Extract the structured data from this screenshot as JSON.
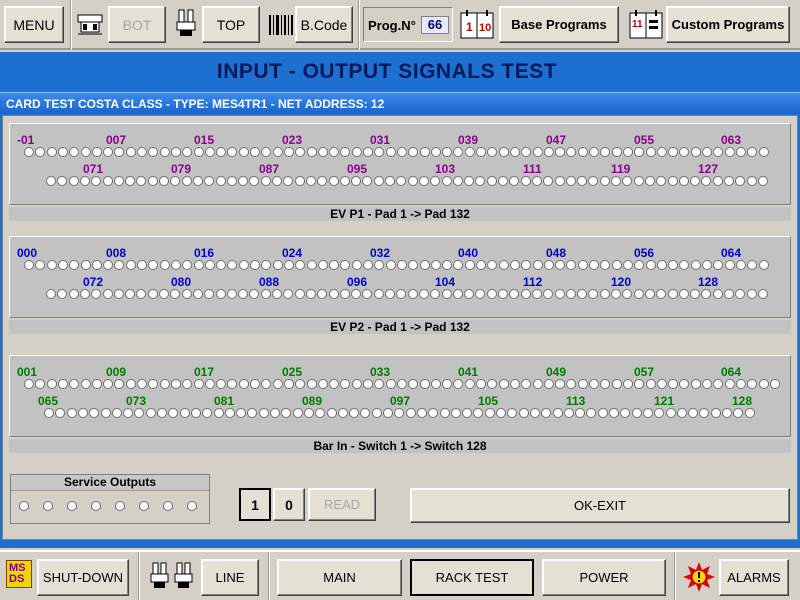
{
  "toolbar": {
    "menu": "MENU",
    "bot": "BOT",
    "top": "TOP",
    "bcode": "B.Code",
    "prog_label": "Prog.N°",
    "prog_value": "66",
    "base_programs": "Base Programs",
    "custom_programs": "Custom Programs",
    "calendar_icon_text": [
      "1",
      "10"
    ],
    "calendar2_icon_text": "11"
  },
  "main": {
    "title": "INPUT - OUTPUT  SIGNALS TEST",
    "card_header": "CARD TEST COSTA CLASS - TYPE: MES4TR1 - NET ADDRESS: 12"
  },
  "groups": [
    {
      "caption": "EV P1 - Pad 1 -> Pad 132",
      "color": "#8b008b",
      "row1_labels": [
        "-01",
        "007",
        "015",
        "023",
        "031",
        "039",
        "047",
        "055",
        "063"
      ],
      "row2_labels": [
        "071",
        "079",
        "087",
        "095",
        "103",
        "111",
        "119",
        "127"
      ],
      "row1_active": [],
      "row2_active": []
    },
    {
      "caption": "EV P2 - Pad 1 -> Pad 132",
      "color": "#0000cc",
      "row1_labels": [
        "000",
        "008",
        "016",
        "024",
        "032",
        "040",
        "048",
        "056",
        "064"
      ],
      "row2_labels": [
        "072",
        "080",
        "088",
        "096",
        "104",
        "112",
        "120",
        "128"
      ],
      "row1_active": [],
      "row2_active": []
    },
    {
      "caption": "Bar In - Switch 1 -> Switch 128",
      "color": "#007a00",
      "row1_labels": [
        "001",
        "009",
        "017",
        "025",
        "033",
        "041",
        "049",
        "057",
        "064"
      ],
      "row2_labels": [
        "065",
        "073",
        "081",
        "089",
        "097",
        "105",
        "113",
        "121",
        "128"
      ],
      "row1_active": [],
      "row2_active": []
    }
  ],
  "service_outputs": {
    "title": "Service Outputs",
    "states": [
      false,
      false,
      false,
      false,
      false,
      false,
      false,
      false
    ]
  },
  "controls": {
    "one": "1",
    "zero": "0",
    "read": "READ",
    "ok_exit": "OK-EXIT"
  },
  "bottombar": {
    "logo_text": "MSDS",
    "shutdown": "SHUT-DOWN",
    "line": "LINE",
    "main": "MAIN",
    "rack_test": "RACK TEST",
    "power": "POWER",
    "alarms": "ALARMS"
  }
}
